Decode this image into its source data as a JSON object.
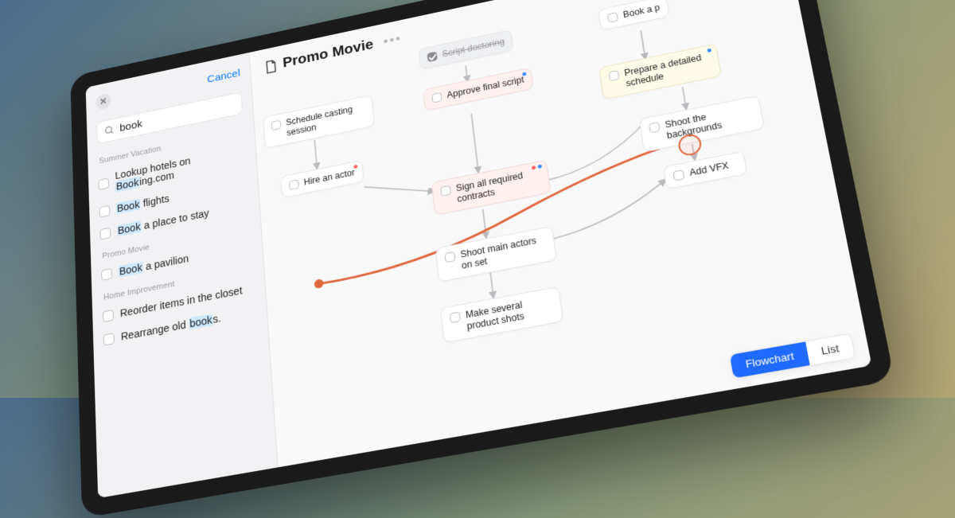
{
  "sidebar": {
    "cancel_label": "Cancel",
    "search": {
      "query": "book"
    },
    "sections": [
      {
        "label": "Summer Vacation",
        "items": [
          {
            "text_pre": "Lookup hotels on ",
            "text_hl": "Book",
            "text_post": "ing.com"
          },
          {
            "text_pre": "",
            "text_hl": "Book",
            "text_post": " flights"
          },
          {
            "text_pre": "",
            "text_hl": "Book",
            "text_post": " a place to stay"
          }
        ]
      },
      {
        "label": "Promo Movie",
        "items": [
          {
            "text_pre": "",
            "text_hl": "Book",
            "text_post": " a pavilion"
          }
        ]
      },
      {
        "label": "Home Improvement",
        "items": [
          {
            "text_pre": "Reorder items in the closet",
            "text_hl": "",
            "text_post": ""
          },
          {
            "text_pre": "Rearrange old ",
            "text_hl": "book",
            "text_post": "s."
          }
        ]
      }
    ]
  },
  "main": {
    "title": "Promo Movie",
    "nodes": {
      "script_doctoring": "Script doctoring",
      "schedule_casting": "Schedule casting session",
      "approve_script": "Approve final script",
      "book_pavilion": "Book a p",
      "hire_actor": "Hire an actor",
      "sign_contracts": "Sign all required contracts",
      "prepare_schedule": "Prepare a detailed schedule",
      "shoot_backgrounds": "Shoot the backgrounds",
      "shoot_main": "Shoot main actors on set",
      "add_vfx": "Add VFX",
      "product_shots": "Make several product shots"
    },
    "toggle": {
      "flowchart": "Flowchart",
      "list": "List"
    }
  }
}
